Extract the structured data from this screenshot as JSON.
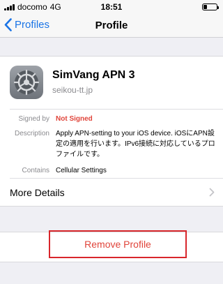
{
  "status_bar": {
    "carrier": "docomo",
    "network": "4G",
    "time": "18:51",
    "battery_level": 0.3
  },
  "nav": {
    "back_label": "Profiles",
    "title": "Profile"
  },
  "profile": {
    "name": "SimVang APN 3",
    "domain": "seikou-tt.jp",
    "icon": "settings-gear-icon",
    "details": {
      "signed_by_label": "Signed by",
      "signed_by_value": "Not Signed",
      "description_label": "Description",
      "description_value": "Apply APN-setting to your iOS device. iOSにAPN設定の適用を行います。IPv6接続に対応しているプロファイルです。",
      "contains_label": "Contains",
      "contains_value": "Cellular Settings"
    },
    "more_details_label": "More Details"
  },
  "actions": {
    "remove_label": "Remove Profile"
  },
  "colors": {
    "accent": "#1a74e6",
    "destructive": "#e0443a",
    "highlight_border": "#d8262b",
    "background": "#efeff4"
  }
}
